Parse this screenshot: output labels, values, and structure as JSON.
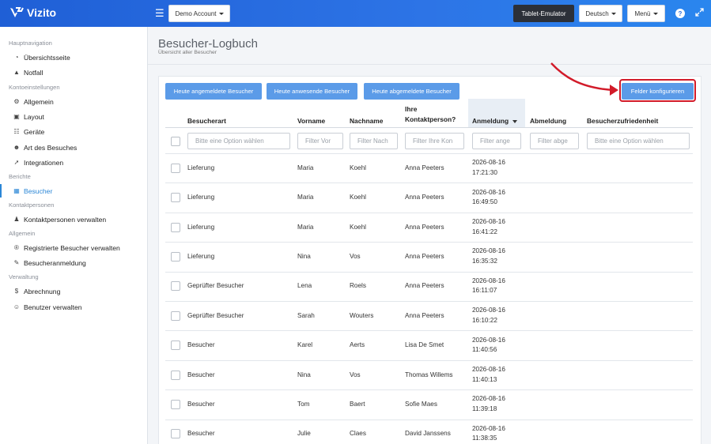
{
  "app": {
    "brand": "Vizito"
  },
  "topbar": {
    "account_label": "Demo Account",
    "tablet_label": "Tablet-Emulator",
    "language_label": "Deutsch",
    "menu_label": "Menü",
    "help_icon": "question-circle-icon",
    "fullscreen_icon": "expand-icon"
  },
  "sidebar": {
    "sections": [
      {
        "title": "Hauptnavigation",
        "items": [
          {
            "label": "Übersichtsseite",
            "icon": "dashboard-icon"
          },
          {
            "label": "Notfall",
            "icon": "warning-icon"
          }
        ]
      },
      {
        "title": "Kontoeinstellungen",
        "items": [
          {
            "label": "Allgemein",
            "icon": "gear-icon"
          },
          {
            "label": "Layout",
            "icon": "image-icon"
          },
          {
            "label": "Geräte",
            "icon": "sitemap-icon"
          },
          {
            "label": "Art des Besuches",
            "icon": "users-icon"
          },
          {
            "label": "Integrationen",
            "icon": "plug-icon"
          }
        ]
      },
      {
        "title": "Berichte",
        "items": [
          {
            "label": "Besucher",
            "icon": "book-icon",
            "active": true
          }
        ]
      },
      {
        "title": "Kontaktpersonen",
        "items": [
          {
            "label": "Kontaktpersonen verwalten",
            "icon": "user-tie-icon"
          }
        ]
      },
      {
        "title": "Allgemein",
        "items": [
          {
            "label": "Registrierte Besucher verwalten",
            "icon": "registered-icon"
          },
          {
            "label": "Besucheranmeldung",
            "icon": "pencil-icon"
          }
        ]
      },
      {
        "title": "Verwaltung",
        "items": [
          {
            "label": "Abrechnung",
            "icon": "dollar-icon"
          },
          {
            "label": "Benutzer verwalten",
            "icon": "user-plus-icon"
          }
        ]
      }
    ]
  },
  "page": {
    "title": "Besucher-Logbuch",
    "subtitle": "Übersicht aller Besucher"
  },
  "actions": {
    "registered_today": "Heute angemeldete Besucher",
    "present_today": "Heute anwesende Besucher",
    "checked_out_today": "Heute abgemeldete Besucher",
    "configure_fields": "Felder konfigurieren"
  },
  "table": {
    "columns": [
      "Besucherart",
      "Vorname",
      "Nachname",
      "Ihre Kontaktperson?",
      "Anmeldung",
      "Abmeldung",
      "Besucherzufriedenheit"
    ],
    "filters": [
      "Bitte eine Option wählen",
      "Filter Vor",
      "Filter Nach",
      "Filter Ihre Kon",
      "Filter ange",
      "Filter abge",
      "Bitte eine Option wählen"
    ],
    "rows": [
      {
        "type": "Lieferung",
        "first": "Maria",
        "last": "Koehl",
        "contact": "Anna Peeters",
        "date": "2026-08-16",
        "time": "17:21:30"
      },
      {
        "type": "Lieferung",
        "first": "Maria",
        "last": "Koehl",
        "contact": "Anna Peeters",
        "date": "2026-08-16",
        "time": "16:49:50"
      },
      {
        "type": "Lieferung",
        "first": "Maria",
        "last": "Koehl",
        "contact": "Anna Peeters",
        "date": "2026-08-16",
        "time": "16:41:22"
      },
      {
        "type": "Lieferung",
        "first": "Nina",
        "last": "Vos",
        "contact": "Anna Peeters",
        "date": "2026-08-16",
        "time": "16:35:32"
      },
      {
        "type": "Geprüfter Besucher",
        "first": "Lena",
        "last": "Roels",
        "contact": "Anna Peeters",
        "date": "2026-08-16",
        "time": "16:11:07"
      },
      {
        "type": "Geprüfter Besucher",
        "first": "Sarah",
        "last": "Wouters",
        "contact": "Anna Peeters",
        "date": "2026-08-16",
        "time": "16:10:22"
      },
      {
        "type": "Besucher",
        "first": "Karel",
        "last": "Aerts",
        "contact": "Lisa De Smet",
        "date": "2026-08-16",
        "time": "11:40:56"
      },
      {
        "type": "Besucher",
        "first": "Nina",
        "last": "Vos",
        "contact": "Thomas Willems",
        "date": "2026-08-16",
        "time": "11:40:13"
      },
      {
        "type": "Besucher",
        "first": "Tom",
        "last": "Baert",
        "contact": "Sofie Maes",
        "date": "2026-08-16",
        "time": "11:39:18"
      },
      {
        "type": "Besucher",
        "first": "Julie",
        "last": "Claes",
        "contact": "David Janssens",
        "date": "2026-08-16",
        "time": "11:38:35"
      }
    ]
  },
  "colors": {
    "accent": "#2a86d6",
    "highlight": "#d21b2a",
    "action_button": "#5b9be8"
  }
}
